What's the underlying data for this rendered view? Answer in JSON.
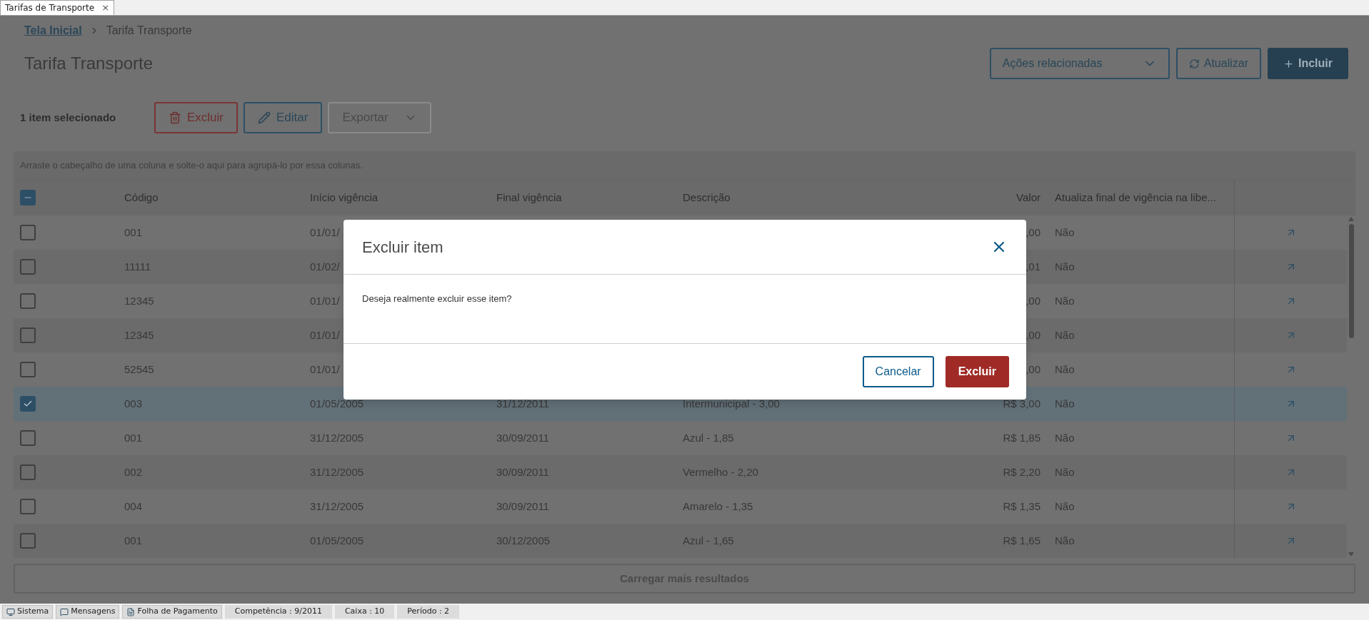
{
  "tab": {
    "title": "Tarifas de Transporte",
    "close": "×"
  },
  "breadcrumb": [
    {
      "label": "Tela Inicial",
      "kind": "link"
    },
    {
      "label": "Tarifa Transporte",
      "kind": "current"
    }
  ],
  "page_title": "Tarifa Transporte",
  "header_actions": {
    "select": "Ações relacionadas",
    "refresh": "Atualizar",
    "add": "Incluir"
  },
  "selection_bar": {
    "count": "1 item selecionado",
    "buttons": [
      {
        "label": "Excluir",
        "kind": "danger",
        "disabled": false
      },
      {
        "label": "Editar",
        "kind": "primary",
        "disabled": false
      },
      {
        "label": "Exportar",
        "kind": "menu",
        "disabled": true
      }
    ]
  },
  "group_hint": "Arraste o cabeçalho de uma coluna e solte-o aqui para agrupá-lo por essa colunas.",
  "table": {
    "header_checkbox": {
      "indeterminate": true
    },
    "columns": [
      "Código",
      "Início vigência",
      "Final vigência",
      "Descrição",
      "Valor",
      "Atualiza final de vigência na libe..."
    ],
    "rows": [
      {
        "selected": false,
        "code": "001",
        "start": "01/01/",
        "value": ",00",
        "update": "Não"
      },
      {
        "selected": false,
        "code": "11111",
        "start": "01/02/",
        "value": ",01",
        "update": "Não"
      },
      {
        "selected": false,
        "code": "12345",
        "start": "01/01/",
        "value": ",00",
        "update": "Não"
      },
      {
        "selected": false,
        "code": "12345",
        "start": "01/01/",
        "value": ",00",
        "update": "Não"
      },
      {
        "selected": false,
        "code": "52545",
        "start": "01/01/",
        "value": ",00",
        "update": "Não"
      },
      {
        "selected": true,
        "code": "003",
        "start": "01/05/2005",
        "end": "31/12/2011",
        "description": "Intermunicipal - 3,00",
        "value": "R$ 3,00",
        "update": "Não"
      },
      {
        "selected": false,
        "code": "001",
        "start": "31/12/2005",
        "end": "30/09/2011",
        "description": "Azul - 1,85",
        "value": "R$ 1,85",
        "update": "Não"
      },
      {
        "selected": false,
        "code": "002",
        "start": "31/12/2005",
        "end": "30/09/2011",
        "description": "Vermelho - 2,20",
        "value": "R$ 2,20",
        "update": "Não"
      },
      {
        "selected": false,
        "code": "004",
        "start": "31/12/2005",
        "end": "30/09/2011",
        "description": "Amarelo - 1,35",
        "value": "R$ 1,35",
        "update": "Não"
      },
      {
        "selected": false,
        "code": "001",
        "start": "01/05/2005",
        "end": "30/12/2005",
        "description": "Azul - 1,65",
        "value": "R$ 1,65",
        "update": "Não"
      }
    ]
  },
  "load_more": {
    "label": "Carregar mais resultados",
    "disabled": true
  },
  "dialog": {
    "title": "Excluir item",
    "message": "Deseja realmente excluir esse item?",
    "buttons": [
      {
        "label": "Cancelar",
        "kind": "secondary"
      },
      {
        "label": "Excluir",
        "kind": "danger"
      }
    ]
  },
  "status_bar": [
    {
      "label": "Sistema",
      "kind": "tab"
    },
    {
      "label": "Mensagens",
      "kind": "tab"
    },
    {
      "label": "Folha de Pagamento",
      "kind": "tab"
    },
    {
      "label": "Competência : 9/2011",
      "kind": "info"
    },
    {
      "label": "Caixa : 10",
      "kind": "info"
    },
    {
      "label": "Período : 2",
      "kind": "info"
    }
  ]
}
